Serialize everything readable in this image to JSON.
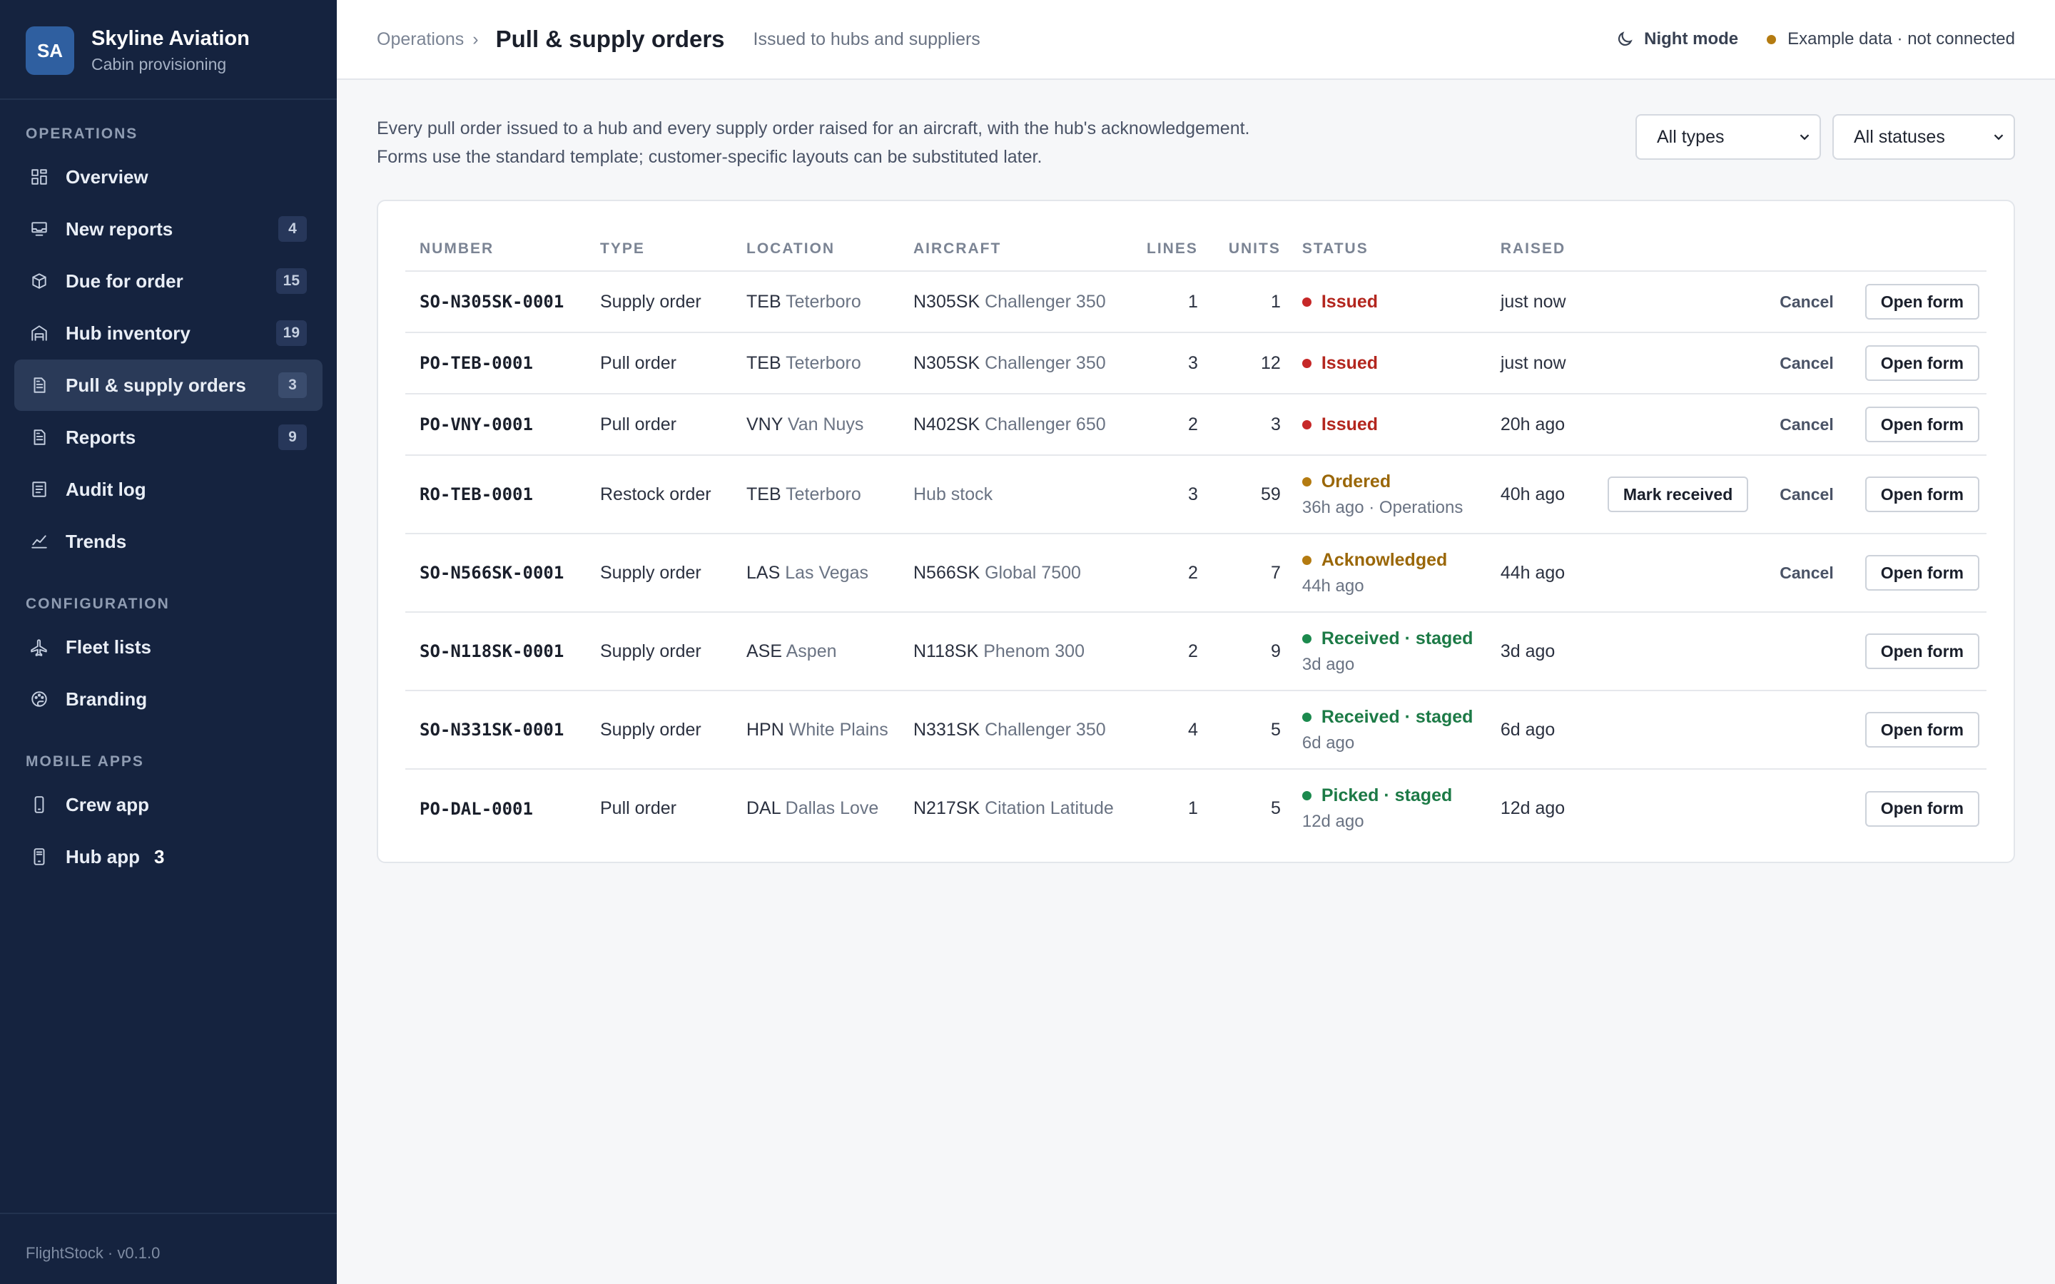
{
  "brand": {
    "initials": "SA",
    "name": "Skyline Aviation",
    "subtitle": "Cabin provisioning"
  },
  "nav": {
    "sections": [
      {
        "title": "OPERATIONS",
        "items": [
          {
            "label": "Overview",
            "icon": "dashboard-icon",
            "badge": ""
          },
          {
            "label": "New reports",
            "icon": "inbox-icon",
            "badge": "4"
          },
          {
            "label": "Due for order",
            "icon": "box-icon",
            "badge": "15"
          },
          {
            "label": "Hub inventory",
            "icon": "warehouse-icon",
            "badge": "19"
          },
          {
            "label": "Pull & supply orders",
            "icon": "document-icon",
            "badge": "3",
            "active": true
          },
          {
            "label": "Reports",
            "icon": "document-icon",
            "badge": "9"
          },
          {
            "label": "Audit log",
            "icon": "list-icon",
            "badge": ""
          },
          {
            "label": "Trends",
            "icon": "trend-icon",
            "badge": ""
          }
        ]
      },
      {
        "title": "CONFIGURATION",
        "items": [
          {
            "label": "Fleet lists",
            "icon": "plane-icon",
            "badge": ""
          },
          {
            "label": "Branding",
            "icon": "palette-icon",
            "badge": ""
          }
        ]
      },
      {
        "title": "MOBILE APPS",
        "items": [
          {
            "label": "Crew app",
            "icon": "phone-icon",
            "badge": ""
          },
          {
            "label": "Hub app",
            "icon": "tablet-icon",
            "badge": "3",
            "plain": true
          }
        ]
      }
    ]
  },
  "footer": "FlightStock · v0.1.0",
  "header": {
    "breadcrumb": "Operations",
    "breadcrumb_sep": "›",
    "title": "Pull & supply orders",
    "subtitle": "Issued to hubs and suppliers",
    "night_mode": "Night mode",
    "connection": "Example data · not connected"
  },
  "intro": "Every pull order issued to a hub and every supply order raised for an aircraft, with the hub's acknowledgement. Forms use the standard template; customer-specific layouts can be substituted later.",
  "filters": {
    "type": "All types",
    "status": "All statuses"
  },
  "table": {
    "columns": [
      "NUMBER",
      "TYPE",
      "LOCATION",
      "AIRCRAFT",
      "LINES",
      "UNITS",
      "STATUS",
      "RAISED"
    ],
    "rows": [
      {
        "number": "SO-N305SK-0001",
        "type": "Supply order",
        "loc_code": "TEB",
        "loc_name": "Teterboro",
        "ac_code": "N305SK",
        "ac_name": "Challenger 350",
        "lines": "1",
        "units": "1",
        "status": "Issued",
        "status_kind": "issued",
        "status_sub": "",
        "raised": "just now",
        "mark": "",
        "cancel": "Cancel",
        "open": "Open form"
      },
      {
        "number": "PO-TEB-0001",
        "type": "Pull order",
        "loc_code": "TEB",
        "loc_name": "Teterboro",
        "ac_code": "N305SK",
        "ac_name": "Challenger 350",
        "lines": "3",
        "units": "12",
        "status": "Issued",
        "status_kind": "issued",
        "status_sub": "",
        "raised": "just now",
        "mark": "",
        "cancel": "Cancel",
        "open": "Open form"
      },
      {
        "number": "PO-VNY-0001",
        "type": "Pull order",
        "loc_code": "VNY",
        "loc_name": "Van Nuys",
        "ac_code": "N402SK",
        "ac_name": "Challenger 650",
        "lines": "2",
        "units": "3",
        "status": "Issued",
        "status_kind": "issued",
        "status_sub": "",
        "raised": "20h ago",
        "mark": "",
        "cancel": "Cancel",
        "open": "Open form"
      },
      {
        "number": "RO-TEB-0001",
        "type": "Restock order",
        "loc_code": "TEB",
        "loc_name": "Teterboro",
        "ac_code": "",
        "ac_name": "Hub stock",
        "lines": "3",
        "units": "59",
        "status": "Ordered",
        "status_kind": "ordered",
        "status_sub": "36h ago · Operations",
        "raised": "40h ago",
        "mark": "Mark received",
        "cancel": "Cancel",
        "open": "Open form"
      },
      {
        "number": "SO-N566SK-0001",
        "type": "Supply order",
        "loc_code": "LAS",
        "loc_name": "Las Vegas",
        "ac_code": "N566SK",
        "ac_name": "Global 7500",
        "lines": "2",
        "units": "7",
        "status": "Acknowledged",
        "status_kind": "ordered",
        "status_sub": "44h ago",
        "raised": "44h ago",
        "mark": "",
        "cancel": "Cancel",
        "open": "Open form"
      },
      {
        "number": "SO-N118SK-0001",
        "type": "Supply order",
        "loc_code": "ASE",
        "loc_name": "Aspen",
        "ac_code": "N118SK",
        "ac_name": "Phenom 300",
        "lines": "2",
        "units": "9",
        "status": "Received · staged",
        "status_kind": "received",
        "status_sub": "3d ago",
        "raised": "3d ago",
        "mark": "",
        "cancel": "",
        "open": "Open form"
      },
      {
        "number": "SO-N331SK-0001",
        "type": "Supply order",
        "loc_code": "HPN",
        "loc_name": "White Plains",
        "ac_code": "N331SK",
        "ac_name": "Challenger 350",
        "lines": "4",
        "units": "5",
        "status": "Received · staged",
        "status_kind": "received",
        "status_sub": "6d ago",
        "raised": "6d ago",
        "mark": "",
        "cancel": "",
        "open": "Open form"
      },
      {
        "number": "PO-DAL-0001",
        "type": "Pull order",
        "loc_code": "DAL",
        "loc_name": "Dallas Love",
        "ac_code": "N217SK",
        "ac_name": "Citation Latitude",
        "lines": "1",
        "units": "5",
        "status": "Picked · staged",
        "status_kind": "received",
        "status_sub": "12d ago",
        "raised": "12d ago",
        "mark": "",
        "cancel": "",
        "open": "Open form"
      }
    ]
  }
}
